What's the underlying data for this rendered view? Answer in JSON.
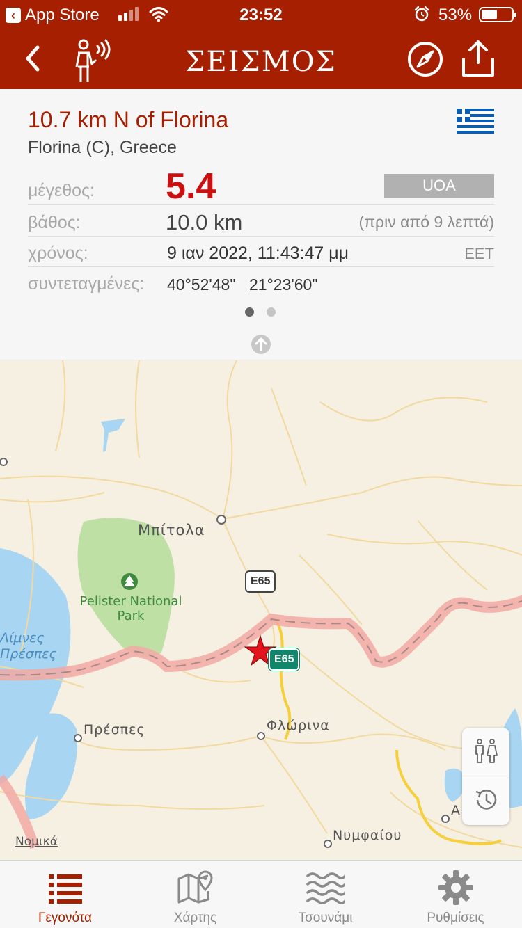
{
  "status_bar": {
    "back_app": "App Store",
    "time": "23:52",
    "battery_pct": "53%",
    "battery_level": 0.53
  },
  "header": {
    "title": "ΣΕΙΣΜΟΣ",
    "icons": [
      "back-chevron-icon",
      "person-signal-icon",
      "compass-icon",
      "share-icon"
    ]
  },
  "event": {
    "place": "10.7 km N of Florina",
    "region": "Florina (C), Greece",
    "magnitude_label": "μέγεθος:",
    "magnitude": "5.4",
    "source": "UOA",
    "depth_label": "βάθος:",
    "depth": "10.0 km",
    "ago": "(πριν από 9 λεπτά)",
    "time_label": "χρόνος:",
    "time": "9 ιαν 2022, 11:43:47 μμ",
    "timezone": "EET",
    "coords_label": "συντεταγμένες:",
    "lat": "40°52'48\"",
    "lon": "21°23'60\"",
    "page_count": 2,
    "active_page": 1
  },
  "map": {
    "cities": [
      "Μπίτολα",
      "Φλώρινα",
      "Πρέσπες",
      "Νυμφαίου",
      "Α"
    ],
    "park": "Pelister National Park",
    "lake_line1": "Λίμνες",
    "lake_line2": "Πρέσπες",
    "road_shield_1": "E65",
    "road_shield_2": "E65",
    "legal": "Νομικά",
    "epicenter_marker": "red-star",
    "controls": [
      "people-icon",
      "history-icon"
    ]
  },
  "tabs": [
    {
      "label": "Γεγονότα",
      "icon": "list-icon",
      "active": true
    },
    {
      "label": "Χάρτης",
      "icon": "map-icon",
      "active": false
    },
    {
      "label": "Τσουνάμι",
      "icon": "waves-icon",
      "active": false
    },
    {
      "label": "Ρυθμίσεις",
      "icon": "gear-icon",
      "active": false
    }
  ],
  "colors": {
    "brand": "#a61f00",
    "magnitude": "#cc1010",
    "active_tab": "#a61f00"
  }
}
